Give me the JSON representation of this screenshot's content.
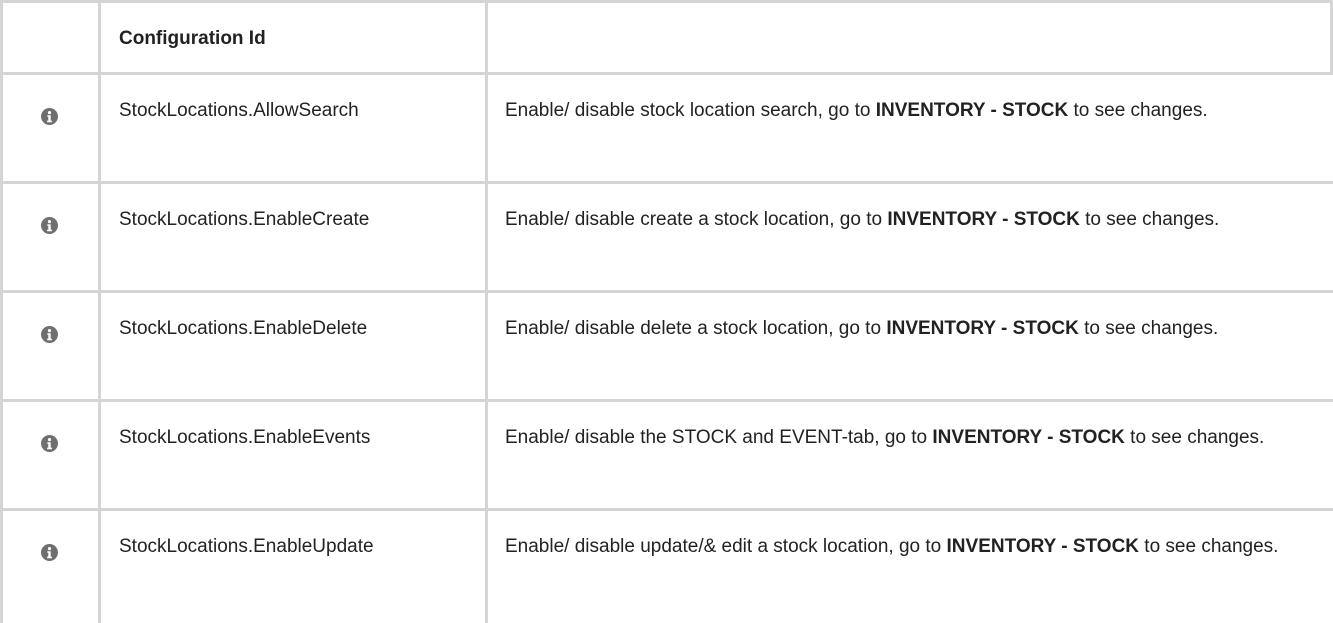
{
  "table": {
    "header": {
      "icon_col": "",
      "id_col": "Configuration Id",
      "desc_col": ""
    },
    "rows": [
      {
        "icon": "info-icon",
        "id": "StockLocations.AllowSearch",
        "desc_pre": "Enable/ disable stock location search, go to ",
        "desc_bold": "INVENTORY - STOCK",
        "desc_post": " to see changes."
      },
      {
        "icon": "info-icon",
        "id": "StockLocations.EnableCreate",
        "desc_pre": "Enable/ disable create a stock location, go to ",
        "desc_bold": "INVENTORY - STOCK",
        "desc_post": " to see changes."
      },
      {
        "icon": "info-icon",
        "id": "StockLocations.EnableDelete",
        "desc_pre": "Enable/ disable delete a stock location, go to ",
        "desc_bold": "INVENTORY - STOCK",
        "desc_post": " to see changes."
      },
      {
        "icon": "info-icon",
        "id": "StockLocations.EnableEvents",
        "desc_pre": "Enable/ disable the STOCK and EVENT-tab, go to ",
        "desc_bold": "INVENTORY - STOCK",
        "desc_post": " to see changes."
      },
      {
        "icon": "info-icon",
        "id": "StockLocations.EnableUpdate",
        "desc_pre": "Enable/ disable update/& edit  a stock location, go to ",
        "desc_bold": "INVENTORY - STOCK",
        "desc_post": " to see changes."
      }
    ]
  },
  "colors": {
    "border": "#d5d5d5",
    "text": "#222222",
    "icon": "#6f6f6f"
  }
}
